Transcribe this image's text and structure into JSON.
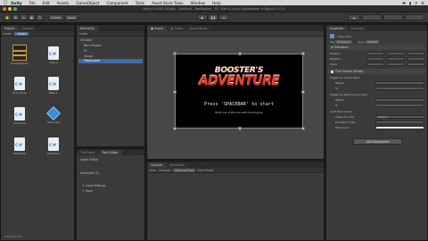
{
  "menubar": {
    "items": [
      "Unity",
      "File",
      "Edit",
      "Assets",
      "GameObject",
      "Component",
      "Tools",
      "Asset Store Tools",
      "Window",
      "Help"
    ]
  },
  "titlebar": {
    "title": "Unity 5.6.0f1 (64bit) - Untitled - ResEngine - PC, Mac & Linux Standalone <OpenGL 4.1>"
  },
  "toolbar": {
    "center": "Center",
    "local": "Local"
  },
  "project": {
    "tabs": [
      "Project",
      "Console"
    ],
    "create_label": "Create",
    "assets_tab": "Assets",
    "assets": [
      {
        "label": "BoosterAdvent",
        "type": "thumb"
      },
      {
        "label": "Data_A",
        "type": "cs"
      },
      {
        "label": "Build_Script",
        "type": "cs"
      },
      {
        "label": "Math_A",
        "type": "cs"
      },
      {
        "label": "LoadScript",
        "type": "cs"
      },
      {
        "label": "New_Cube",
        "type": "cube"
      },
      {
        "label": "FileHandler",
        "type": "cs"
      },
      {
        "label": "Workspace",
        "type": "cs"
      }
    ]
  },
  "hierarchy": {
    "tabs": [
      "Hierarchy"
    ],
    "create_label": "Create",
    "items": [
      "Untitled",
      "Rect Engine",
      "UI",
      "Visual",
      "Titlescreen"
    ]
  },
  "scene": {
    "tabs": [
      "Scene",
      "Game",
      "Asset Store"
    ],
    "title_line1": "BOOSTER'S",
    "title_line2": "ADVENTURE",
    "prompt": "Press 'SPACEBAR' to start",
    "credit": "Built out of the box with the Engine"
  },
  "layer_editor": {
    "tabs": [
      "Tile Editor",
      "Rect Editor"
    ],
    "title": "Layer Editor",
    "items": [
      "Unlocked (1)",
      "+ Load Settings",
      "+ Save"
    ]
  },
  "console": {
    "tabs": [
      "Console",
      "Animation"
    ],
    "buttons": [
      "Clear",
      "Collapse",
      "Clear on Play",
      "Error Pause"
    ]
  },
  "inspector": {
    "tabs": [
      "Inspector",
      "Services"
    ],
    "object_name": "Titlescreen",
    "tag_label": "Tag",
    "tag_value": "Untagged",
    "layer_label": "Layer",
    "layer_value": "Default",
    "transform_label": "Transform",
    "rows": [
      "Position",
      "Rotation",
      "Scale"
    ],
    "script_label": "Title Screen (Script)",
    "sections": [
      "Toggle On Scene Start",
      "Toggle On New Screen Load",
      "Load New Scene"
    ],
    "fields": [
      "Object",
      "UI",
      "Object",
      "UI",
      "Scene To Load",
      "Transition Type",
      "Fade Color"
    ],
    "scene_value": "Level_1",
    "add_component": "Add Component"
  },
  "colors": {
    "title_top": "#f2e7d2",
    "title_bottom": "#c9231d",
    "accent": "#3b79b4"
  }
}
